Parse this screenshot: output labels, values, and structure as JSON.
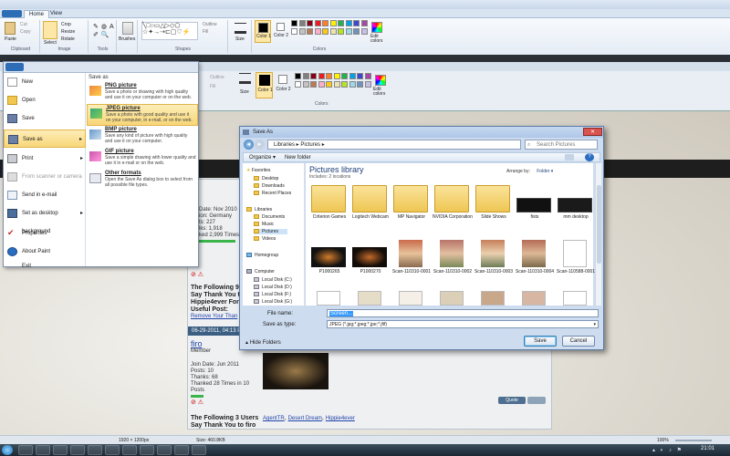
{
  "paint_top": {
    "tabs": [
      "Home",
      "View"
    ],
    "clipboard": {
      "paste": "Paste",
      "cut": "Cut",
      "copy": "Copy",
      "label": "Clipboard"
    },
    "image": {
      "select": "Select",
      "crop": "Crop",
      "resize": "Resize",
      "rotate": "Rotate",
      "label": "Image"
    },
    "tools": {
      "label": "Tools"
    },
    "brushes": "Brushes",
    "shapes": {
      "outline": "Outline",
      "fill": "Fill",
      "label": "Shapes"
    },
    "size": "Size",
    "color1": "Color 1",
    "color2": "Color 2",
    "colors_label": "Colors",
    "edit_colors": "Edit colors"
  },
  "paint_second": {
    "outline": "Outline",
    "fill": "Fill",
    "size": "Size",
    "color1": "Color 1",
    "color2": "Color 2",
    "edit_colors": "Edit colors",
    "colors_label": "Colors"
  },
  "palette": [
    "#000000",
    "#7f7f7f",
    "#880015",
    "#ed1c24",
    "#ff7f27",
    "#fff200",
    "#22b14c",
    "#00a2e8",
    "#3f48cc",
    "#a349a4",
    "#ffffff",
    "#c3c3c3",
    "#b97a57",
    "#ffaec9",
    "#ffc90e",
    "#efe4b0",
    "#b5e61d",
    "#99d9ea",
    "#7092be",
    "#c8bfe7"
  ],
  "file_menu": {
    "items": [
      "New",
      "Open",
      "Save",
      "Save as",
      "Print",
      "From scanner or camera",
      "Send in e-mail",
      "Set as desktop background",
      "Properties",
      "About Paint",
      "Exit"
    ],
    "save_as_header": "Save as",
    "options": [
      {
        "title": "PNG picture",
        "desc": "Save a photo or drawing with high quality and use it on your computer or on the web."
      },
      {
        "title": "JPEG picture",
        "desc": "Save a photo with good quality and use it on your computer, in e-mail, or on the web."
      },
      {
        "title": "BMP picture",
        "desc": "Save any kind of picture with high quality and use it on your computer."
      },
      {
        "title": "GIF picture",
        "desc": "Save a simple drawing with lower quality and use it in e-mail or on the web."
      },
      {
        "title": "Other formats",
        "desc": "Open the Save As dialog box to select from all possible file types."
      }
    ]
  },
  "forum": {
    "profile_lines": [
      "Date: Nov 2010",
      "ion: Germany",
      "ts: 227",
      "lks: 1,918",
      "ked 2,999 Times in"
    ],
    "thanks_title": "The Following 9 U Say Thank You to Hippie4ever For Useful Post:",
    "remove_link": "Remove Your Than",
    "post_date": "06-29-2011, 04:13 PM",
    "username": "firo",
    "member": "Member",
    "details": [
      "Join Date: Jun 2011",
      "Posts: 10",
      "Thanks: 68",
      "Thanked 28 Times in 10 Posts"
    ],
    "quote": "Quote",
    "thanks_bottom": "The Following 3 Users Say Thank You to firo",
    "thankers": [
      "AgentTR",
      "Desert Dream",
      "Hippie4ever"
    ]
  },
  "dialog": {
    "title": "Save As",
    "address": "Libraries ▸ Pictures ▸",
    "search_placeholder": "Search Pictures",
    "organize": "Organize ▾",
    "new_folder": "New folder",
    "nav": {
      "favorites": "Favorites",
      "desktop": "Desktop",
      "downloads": "Downloads",
      "recent": "Recent Places",
      "libraries": "Libraries",
      "documents": "Documents",
      "music": "Music",
      "pictures": "Pictures",
      "videos": "Videos",
      "homegroup": "Homegroup",
      "computer": "Computer",
      "disk_c": "Local Disk (C:)",
      "disk_d": "Local Disk (D:)",
      "disk_f": "Local Disk (F:)",
      "disk_g": "Local Disk (G:)"
    },
    "library_title": "Pictures library",
    "includes": "Includes: 2 locations",
    "arrange_label": "Arrange by:",
    "arrange_value": "Folder ▾",
    "row1": [
      "Criterion Games",
      "Logitech Webcam",
      "MP Navigator",
      "NVIDIA Corporation",
      "Slide Shows",
      "fists",
      "mm desktop"
    ],
    "row2": [
      "P1000265",
      "P1000270",
      "Scan-110310-0001",
      "Scan-110310-0002",
      "Scan-110310-0003",
      "Scan-110310-0004",
      "Scan-110588-0001"
    ],
    "file_name_label": "File name:",
    "file_name_value": "Screen...",
    "save_type_label": "Save as type:",
    "save_type_value": "JPEG (*.jpg;*.jpeg;*.jpe;*.jfif)",
    "hide_folders": "Hide Folders",
    "save": "Save",
    "cancel": "Cancel"
  },
  "status_bar": {
    "dimensions": "1920 × 1200px",
    "size": "Size: 460.8KB",
    "zoom": "100%"
  },
  "clock": "21:01"
}
